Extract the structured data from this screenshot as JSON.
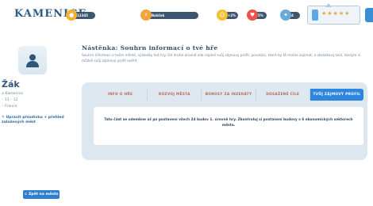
{
  "app": {
    "logo": "KAMENICE"
  },
  "resources": [
    {
      "icon": "coin-icon",
      "value": "12345",
      "color": "#f2b134"
    },
    {
      "icon": "energy-icon",
      "value": "Balíček",
      "color": "#f2a53a"
    },
    {
      "icon": "happiness-icon",
      "value": "+2%",
      "color": "#f2c12f"
    },
    {
      "icon": "heart-icon",
      "value": "5%",
      "color": "#e8534c"
    },
    {
      "icon": "award-icon",
      "value": "4",
      "color": "#6aa8d8"
    }
  ],
  "level": {
    "stars": "★★★★★"
  },
  "player": {
    "role": "Žák",
    "town": "Kamenice",
    "age": "11 - 12",
    "country": "France",
    "edit_link": "Upravit přezdívku + přehled založených měst"
  },
  "back_button": "< Zpět na město",
  "page": {
    "title": "Nástěnka: Souhrn informací o tvé hře",
    "intro": "Souhrn informací o tvém městě, výsledky tvé hry. Od druhé úrovně zde najdeš svůj zájmový profil, povolání, které by tě mohlo zajímat, a obrázkový test, kterým si můžeš svůj zájmový profil ověřit."
  },
  "tabs": [
    {
      "label": "Info o hře",
      "active": false
    },
    {
      "label": "Rozvoj města",
      "active": false
    },
    {
      "label": "Bonusy za inzeráty",
      "active": false
    },
    {
      "label": "Dosažené cíle",
      "active": false
    },
    {
      "label": "Tvůj zájmový profil",
      "active": true
    }
  ],
  "content": {
    "message": "Tato část se odemkne až po postavení všech 24 budov 1. úrovně hry. Zkontroluj si postavení budovy s 6 ekonomických sektorech města."
  },
  "colors": {
    "accent": "#2e86de",
    "title": "#35506e",
    "tab_text": "#b36a57"
  }
}
